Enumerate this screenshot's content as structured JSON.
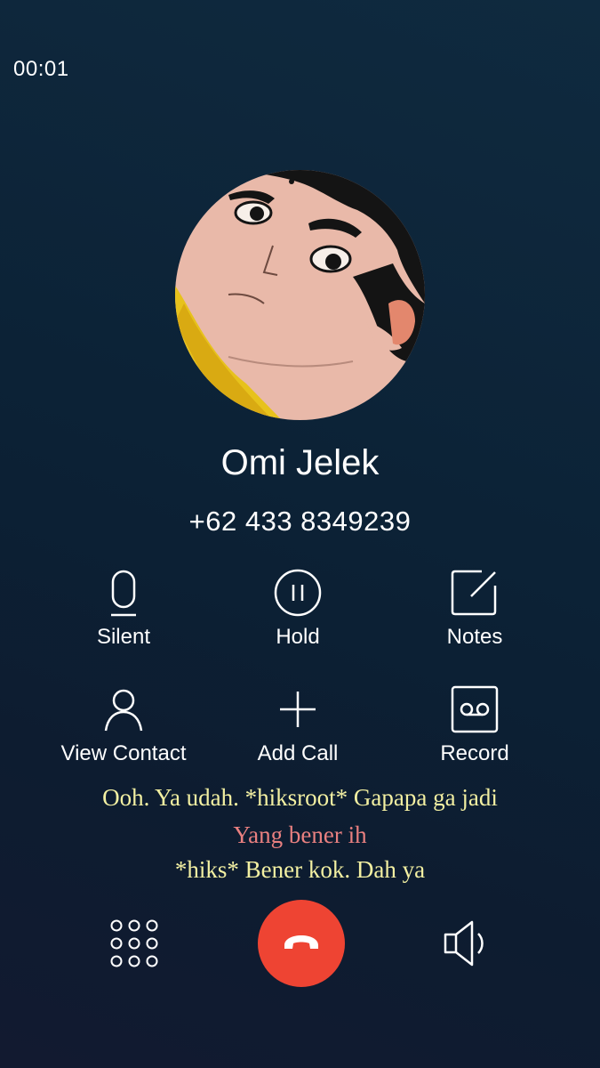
{
  "call": {
    "timer": "00:01",
    "contact_name": "Omi Jelek",
    "phone_number": "+62 433 8349239"
  },
  "actions": {
    "silent": {
      "label": "Silent",
      "icon": "microphone-icon"
    },
    "hold": {
      "label": "Hold",
      "icon": "pause-icon"
    },
    "notes": {
      "label": "Notes",
      "icon": "notes-icon"
    },
    "view_contact": {
      "label": "View Contact",
      "icon": "person-icon"
    },
    "add_call": {
      "label": "Add Call",
      "icon": "plus-icon"
    },
    "record": {
      "label": "Record",
      "icon": "record-tape-icon"
    }
  },
  "transcript": [
    {
      "text": "Ooh. Ya udah. *hiksroot* Gapapa ga jadi",
      "color": "#f3f0a2"
    },
    {
      "text": "Yang bener ih",
      "color": "#e98080"
    },
    {
      "text": "*hiks* Bener kok. Dah ya",
      "color": "#f3f0a2"
    }
  ],
  "bottom_bar": {
    "keypad_icon": "dialpad-icon",
    "end_call_icon": "hang-up-icon",
    "end_call_color": "#ee4433",
    "speaker_icon": "speaker-icon"
  }
}
